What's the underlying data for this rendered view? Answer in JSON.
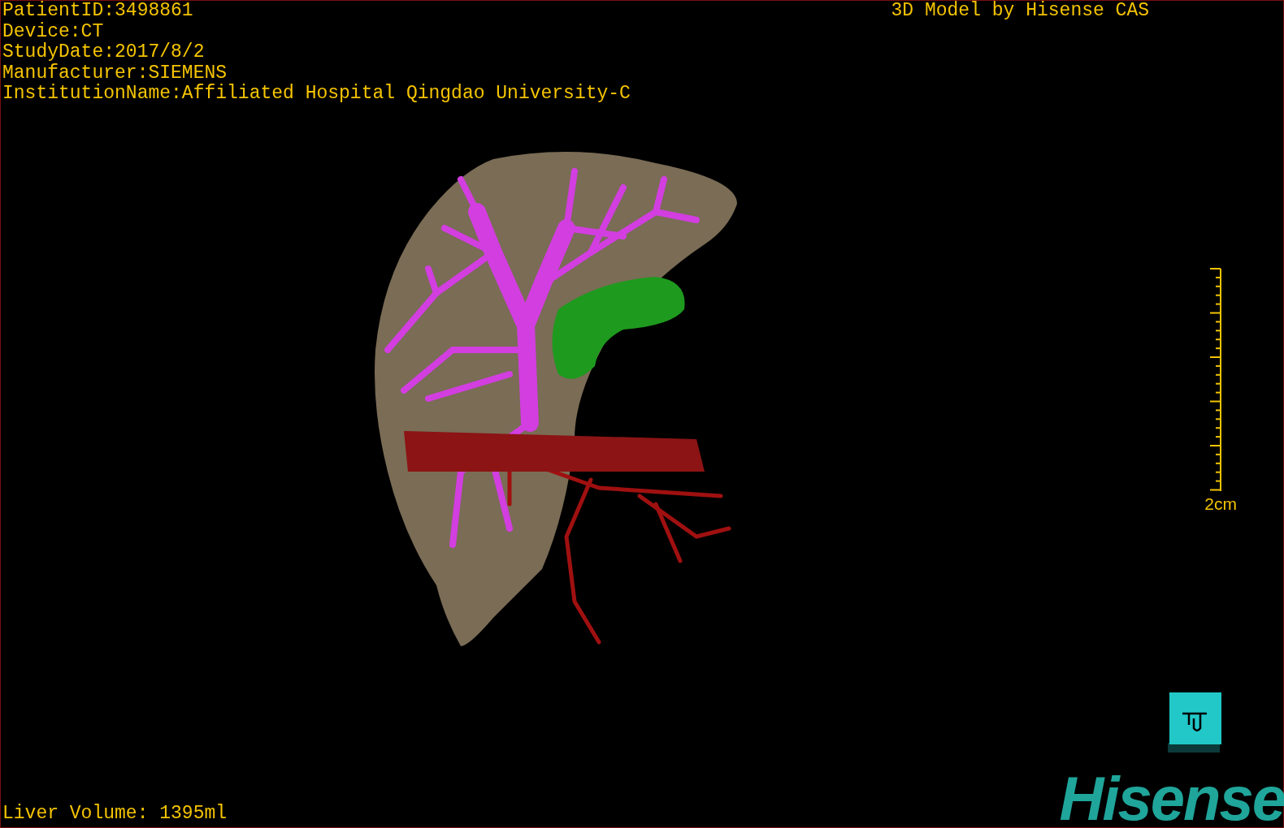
{
  "patient_info": [
    "PatientID:3498861",
    "Device:CT",
    "StudyDate:2017/8/2",
    "Manufacturer:SIEMENS",
    "InstitutionName:Affiliated Hospital Qingdao University-C"
  ],
  "model_title": "3D Model by Hisense CAS",
  "scale_bar": {
    "label": "2cm"
  },
  "liver_volume": "Liver Volume: 1395ml",
  "logo": "Hisense"
}
